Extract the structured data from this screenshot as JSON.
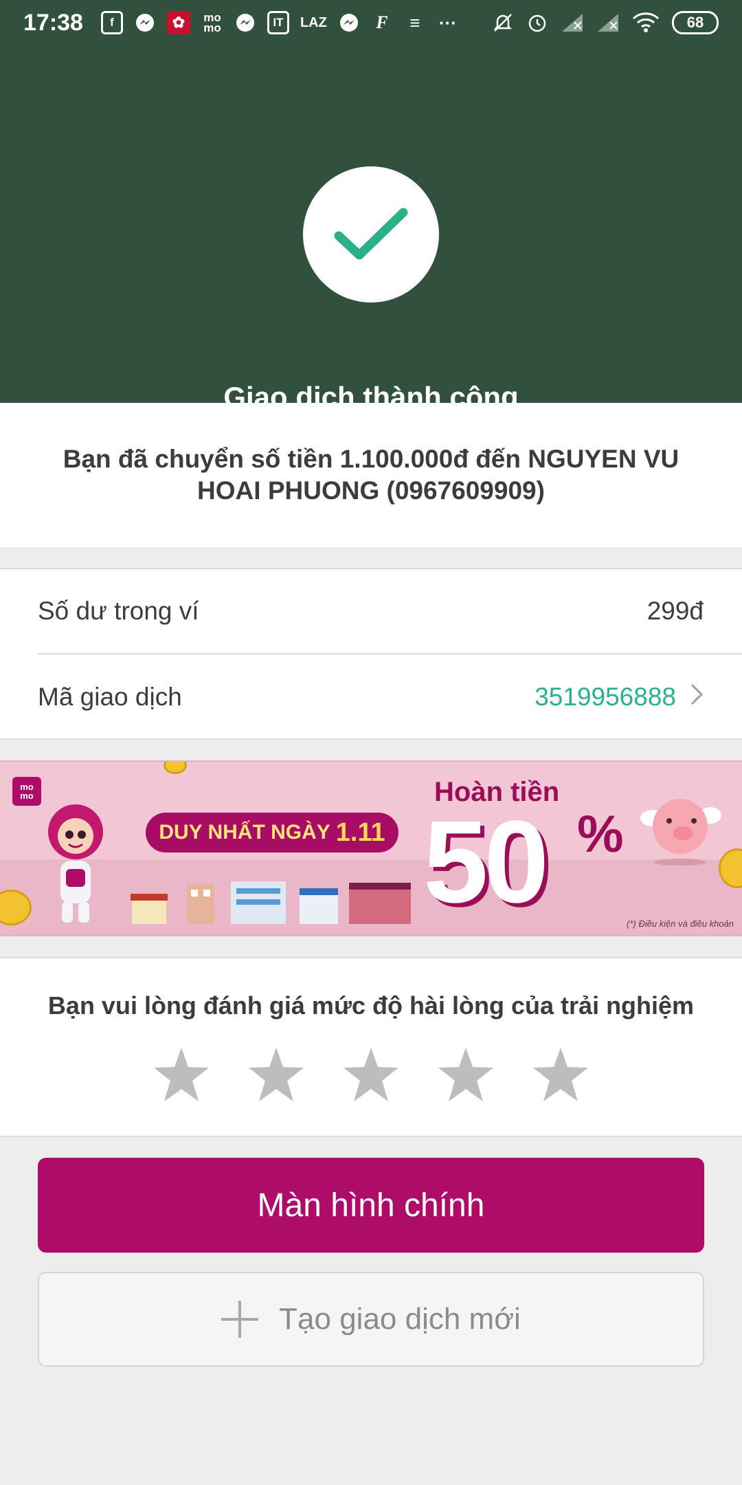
{
  "status_bar": {
    "time": "17:38",
    "icons": [
      "facebook-icon",
      "messenger-icon",
      "app-icon",
      "momo-icon",
      "messenger-icon",
      "shopping-icon",
      "lazada-icon",
      "messenger-icon",
      "f-icon",
      "lines-icon",
      "more-icon",
      "mute-icon",
      "alarm-icon",
      "signal-icon",
      "signal-icon",
      "wifi-icon"
    ],
    "battery": "68"
  },
  "hero": {
    "title": "Giao dịch thành công",
    "accent": "#2bb08a",
    "background": "#31513e"
  },
  "message": {
    "text": "Bạn đã chuyển số tiền 1.100.000đ đến NGUYEN VU HOAI PHUONG (0967609909)"
  },
  "info": {
    "balance_label": "Số dư trong ví",
    "balance_value": "299đ",
    "txn_label": "Mã giao dịch",
    "txn_value": "3519956888"
  },
  "banner": {
    "logo": "mo mo",
    "pill_text": "DUY NHẤT NGÀY",
    "pill_date": "1.11",
    "headline": "Hoàn tiền",
    "big_number": "50",
    "percent": "%",
    "footnote": "(*) Điều kiện và điều khoản"
  },
  "rating": {
    "prompt": "Bạn vui lòng đánh giá mức độ hài lòng của trải nghiệm",
    "stars": 0,
    "max_stars": 5
  },
  "buttons": {
    "main_label": "Màn hình chính",
    "new_label": "Tạo giao dịch mới"
  },
  "colors": {
    "brand": "#ad0c68",
    "success": "#2bb08a"
  }
}
